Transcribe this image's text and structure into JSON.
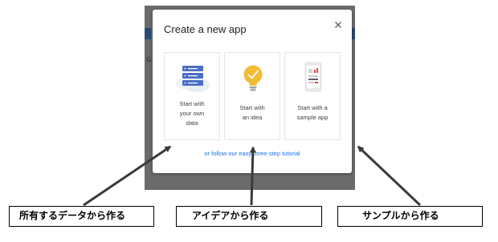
{
  "dialog": {
    "title": "Create a new app",
    "close_icon": "close-icon",
    "cards": [
      {
        "icon": "database-icon",
        "label": "Start with\nyour own\ndata"
      },
      {
        "icon": "lightbulb-icon",
        "label": "Start with\nan idea"
      },
      {
        "icon": "mobile-app-icon",
        "label": "Start with a\nsample app"
      }
    ],
    "tutorial_link": "or follow our easy three-step tutorial"
  },
  "background": {
    "partial_text": "G"
  },
  "annotations": [
    "所有するデータから作る",
    "アイデアから作る",
    "サンプルから作る"
  ],
  "colors": {
    "backdrop": "#6b6b6b",
    "link": "#1a73e8",
    "database": "#4a6fc4",
    "lightbulb": "#f2bb35"
  }
}
